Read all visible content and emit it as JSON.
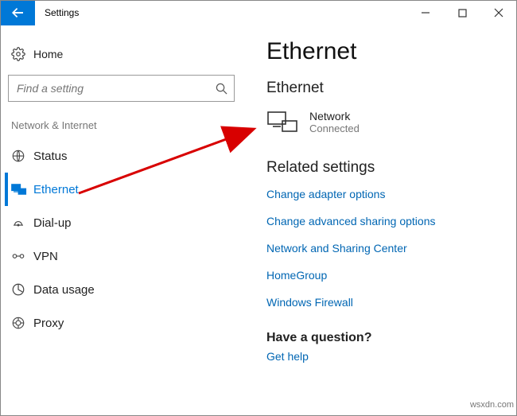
{
  "titlebar": {
    "title": "Settings"
  },
  "sidebar": {
    "home": "Home",
    "search_placeholder": "Find a setting",
    "category": "Network & Internet",
    "items": [
      {
        "icon": "status-icon",
        "label": "Status"
      },
      {
        "icon": "ethernet-icon",
        "label": "Ethernet"
      },
      {
        "icon": "dialup-icon",
        "label": "Dial-up"
      },
      {
        "icon": "vpn-icon",
        "label": "VPN"
      },
      {
        "icon": "datausage-icon",
        "label": "Data usage"
      },
      {
        "icon": "proxy-icon",
        "label": "Proxy"
      }
    ]
  },
  "main": {
    "title": "Ethernet",
    "section": "Ethernet",
    "network": {
      "name": "Network",
      "status": "Connected"
    },
    "related_heading": "Related settings",
    "links": [
      "Change adapter options",
      "Change advanced sharing options",
      "Network and Sharing Center",
      "HomeGroup",
      "Windows Firewall"
    ],
    "question_heading": "Have a question?",
    "help_link": "Get help"
  },
  "watermark": "wsxdn.com"
}
